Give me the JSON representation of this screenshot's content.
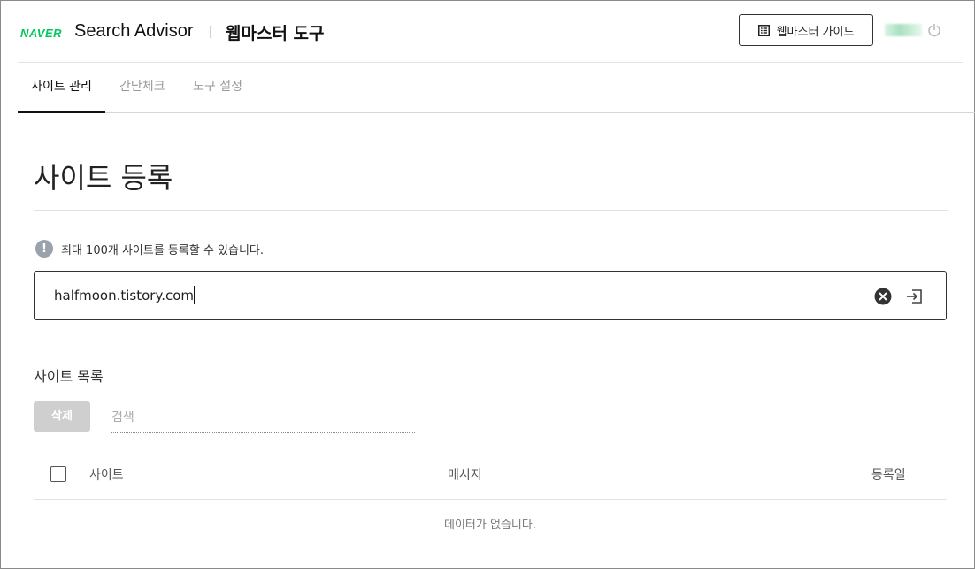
{
  "header": {
    "logo": "NAVER",
    "brand": "Search Advisor",
    "tool_title": "웹마스터 도구",
    "guide_button": "웹마스터 가이드",
    "icons": {
      "guide": "list-icon",
      "power": "power-icon"
    }
  },
  "tabs": [
    {
      "label": "사이트 관리",
      "active": true
    },
    {
      "label": "간단체크",
      "active": false
    },
    {
      "label": "도구 설정",
      "active": false
    }
  ],
  "main": {
    "title": "사이트 등록",
    "notice": "최대 100개 사이트를 등록할 수 있습니다.",
    "notice_icon": "!",
    "url_value": "halfmoon.tistory.com"
  },
  "site_list": {
    "title": "사이트 목록",
    "delete_button": "삭제",
    "search_placeholder": "검색",
    "columns": {
      "site": "사이트",
      "message": "메시지",
      "registered": "등록일"
    },
    "empty_message": "데이터가 없습니다."
  },
  "colors": {
    "brand_green": "#03c75a",
    "disabled_button": "#cfcfcf"
  }
}
